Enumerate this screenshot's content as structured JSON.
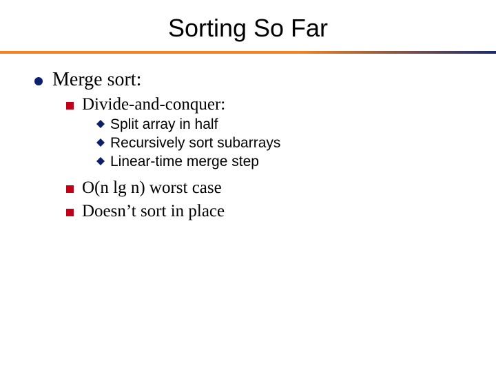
{
  "title": "Sorting So Far",
  "lvl1": {
    "label": "Merge sort:"
  },
  "lvl2a": {
    "label": "Divide-and-conquer:"
  },
  "lvl3": {
    "items": [
      "Split array in half",
      "Recursively sort subarrays",
      "Linear-time merge step"
    ]
  },
  "lvl2b": {
    "label": "O(n lg n) worst case"
  },
  "lvl2c": {
    "label": "Doesn’t sort in place"
  },
  "icons": {
    "circle": "circle-bullet-icon",
    "square": "square-bullet-icon",
    "diamond": "diamond-bullet-icon"
  },
  "colors": {
    "title": "#000000",
    "ruleLeft": "#f58220",
    "ruleRight": "#1a2a6c",
    "lvl1Bullet": "#0b1f6b",
    "lvl2Bullet": "#c00018",
    "lvl3Bullet": "#0b1f6b"
  }
}
